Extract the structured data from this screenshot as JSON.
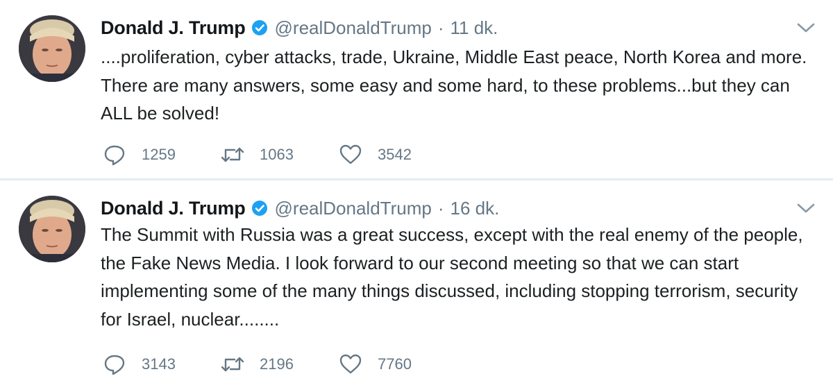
{
  "tweets": [
    {
      "name": "Donald J. Trump",
      "handle": "@realDonaldTrump",
      "separator": "·",
      "time": "11 dk.",
      "text": "....proliferation, cyber attacks, trade, Ukraine, Middle East peace, North Korea and more. There are many answers, some easy and some hard, to these problems...but they can ALL be solved!",
      "replies": "1259",
      "retweets": "1063",
      "likes": "3542"
    },
    {
      "name": "Donald J. Trump",
      "handle": "@realDonaldTrump",
      "separator": "·",
      "time": "16 dk.",
      "text": "The Summit with Russia was a great success, except with the real enemy of the people, the Fake News Media. I look forward to our second meeting so that we can start implementing some of the many things discussed, including stopping terrorism, security for Israel, nuclear........",
      "replies": "3143",
      "retweets": "2196",
      "likes": "7760"
    }
  ],
  "icons": {
    "verified": "verified-badge-icon",
    "caret": "chevron-down-icon",
    "reply": "reply-icon",
    "retweet": "retweet-icon",
    "like": "heart-icon"
  },
  "colors": {
    "name": "#14171a",
    "secondary": "#657786",
    "verified": "#1da1f2",
    "divider": "#e6ecf0"
  }
}
